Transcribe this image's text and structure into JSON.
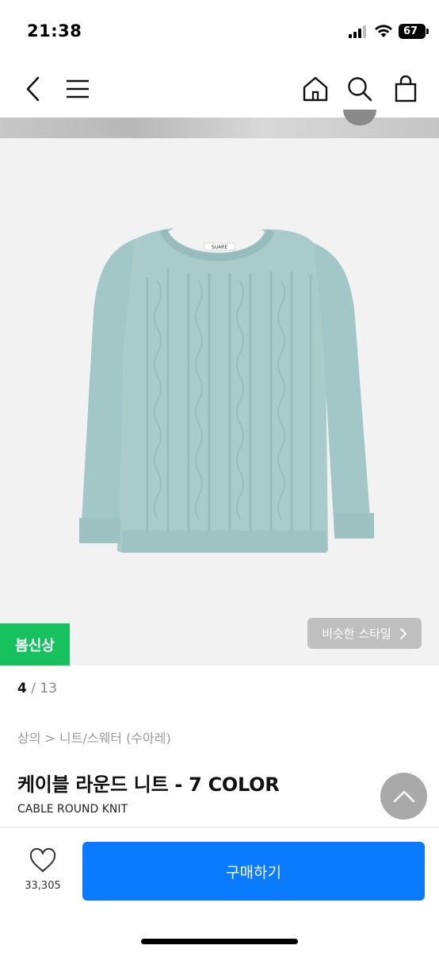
{
  "status_bar": {
    "time": "21:38",
    "battery": "67"
  },
  "nav": {
    "back_icon": "chevron-left-icon",
    "menu_icon": "hamburger-icon",
    "home_icon": "home-icon",
    "search_icon": "search-icon",
    "cart_icon": "shopping-bag-icon"
  },
  "product": {
    "badge": "봄신상",
    "similar_style": "비슷한 스타일",
    "pager_current": "4",
    "pager_separator": "/",
    "pager_total": "13",
    "breadcrumb": "상의 > 니트/스웨터 (수아레)",
    "title": "케이블 라운드 니트 - 7 COLOR",
    "subtitle": "CABLE ROUND KNIT",
    "image_label": "SUARE",
    "sweater_color": "#a9cccb"
  },
  "bottom_bar": {
    "like_count": "33,305",
    "buy_label": "구매하기",
    "buy_color": "#0a7aff"
  }
}
